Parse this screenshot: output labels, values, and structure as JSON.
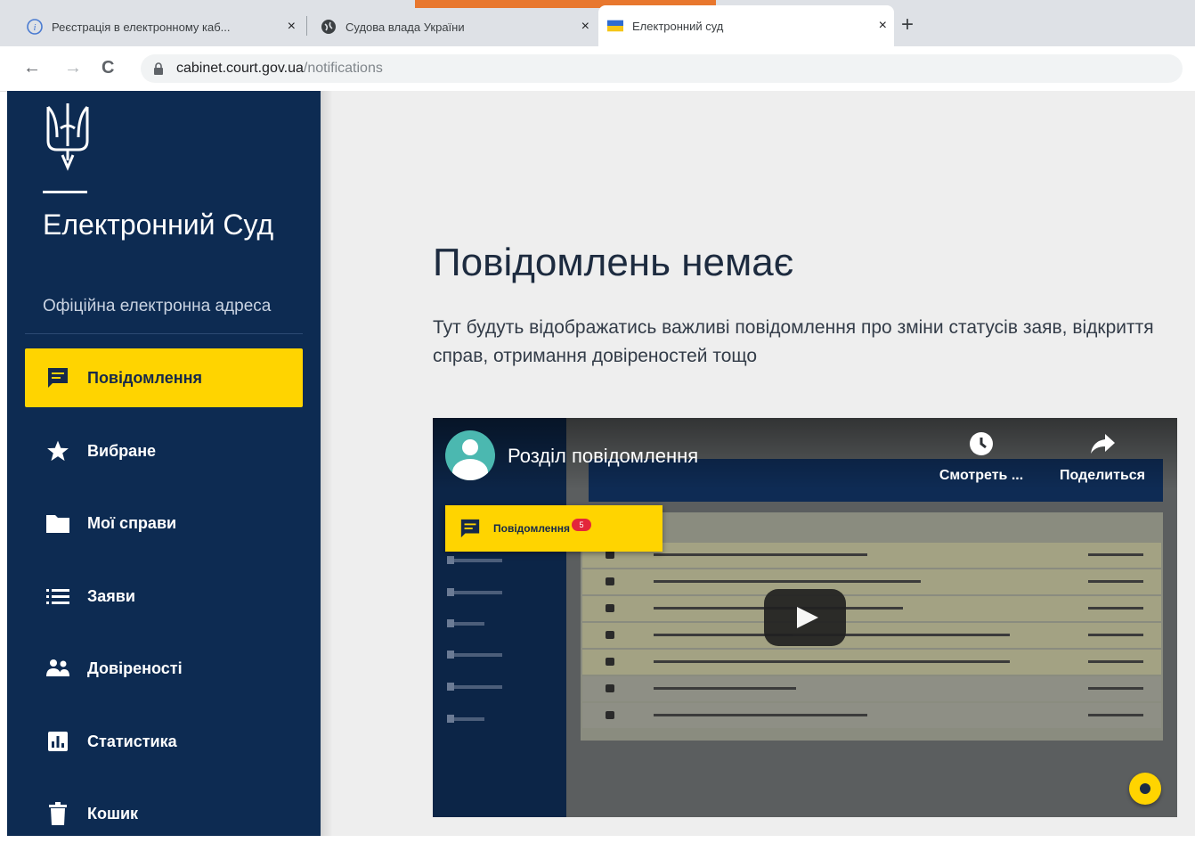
{
  "browser": {
    "tabs": [
      {
        "label": "Реєстрація в електронному каб...",
        "icon": "info-icon",
        "active": false
      },
      {
        "label": "Судова влада України",
        "icon": "globe-icon",
        "active": false
      },
      {
        "label": "Електронний суд",
        "icon": "ukraine-flag-icon",
        "active": true
      }
    ],
    "close_glyph": "×",
    "new_tab_glyph": "+",
    "back_glyph": "←",
    "forward_glyph": "→",
    "reload_glyph": "C",
    "url_host": "cabinet.court.gov.ua",
    "url_path": "/notifications"
  },
  "sidebar": {
    "brand_title": "Електронний Суд",
    "brand_subtitle": "Офіційна електронна адреса",
    "items": [
      {
        "label": "Повідомлення",
        "icon": "message-icon",
        "active": true
      },
      {
        "label": "Вибране",
        "icon": "star-icon",
        "active": false
      },
      {
        "label": "Мої справи",
        "icon": "folder-icon",
        "active": false
      },
      {
        "label": "Заяви",
        "icon": "list-icon",
        "active": false
      },
      {
        "label": "Довіреності",
        "icon": "people-icon",
        "active": false
      },
      {
        "label": "Статистика",
        "icon": "chart-icon",
        "active": false
      },
      {
        "label": "Кошик",
        "icon": "trash-icon",
        "active": false
      }
    ]
  },
  "main": {
    "heading": "Повідомлень немає",
    "description": "Тут будуть відображатись важливі повідомлення про зміни статусів заяв, відкриття справ, отримання довіреностей тощо"
  },
  "video": {
    "title": "Розділ повідомлення",
    "watch_label": "Смотреть ...",
    "share_label": "Поделиться",
    "highlight_label": "Повідомлення",
    "highlight_badge": "5"
  },
  "colors": {
    "sidebar_bg": "#0d2b52",
    "active_item": "#ffd400",
    "main_bg": "#eeeeee",
    "heading": "#1d2b3f"
  }
}
